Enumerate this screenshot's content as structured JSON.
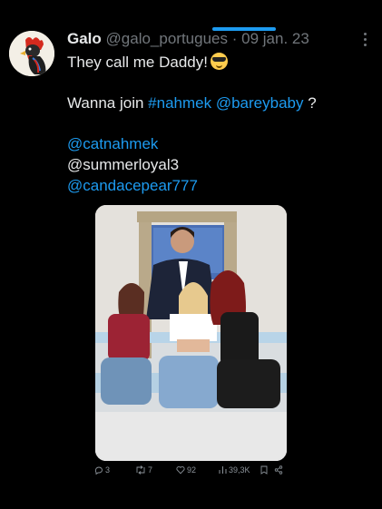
{
  "tweet": {
    "author_name": "Galo",
    "handle": "@galo_portugues",
    "separator": "·",
    "date": "09 jan. 23",
    "line1": "They call me Daddy!",
    "line2_prefix": "Wanna join",
    "hashtag": "#nahmek",
    "mention_inline": "@bareybaby",
    "line2_suffix": "?",
    "mentions": [
      "@catnahmek",
      "@summerloyal3",
      "@candacepear777"
    ]
  },
  "actions": {
    "replies": "3",
    "retweets": "7",
    "likes": "92",
    "views": "39,3K"
  },
  "icons": {
    "avatar": "rooster-avatar",
    "emoji": "sunglasses-emoji",
    "more": "more-options-icon",
    "reply": "reply-icon",
    "retweet": "retweet-icon",
    "like": "heart-icon",
    "views": "views-icon",
    "bookmark": "bookmark-icon",
    "share": "share-icon"
  },
  "colors": {
    "background": "#000000",
    "link": "#1d9bf0",
    "secondary": "#71767b"
  }
}
